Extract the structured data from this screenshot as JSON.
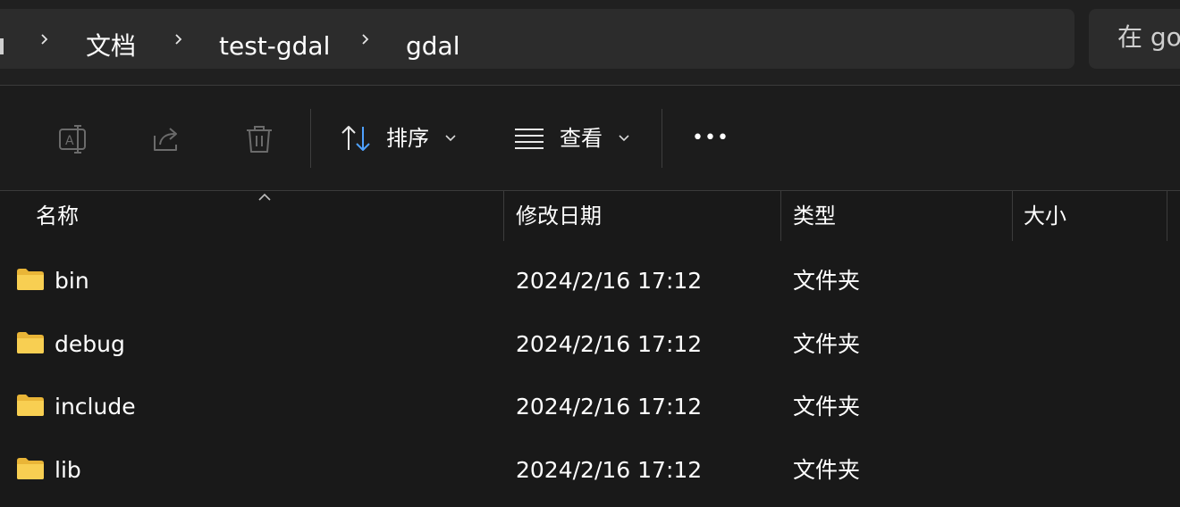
{
  "address_bar": {
    "breadcrumbs": [
      "文档",
      "test-gdal",
      "gdal"
    ]
  },
  "search": {
    "text": "在 go"
  },
  "command_bar": {
    "icons": [
      "rename-icon",
      "share-icon",
      "delete-icon"
    ],
    "sort_label": "排序",
    "view_label": "查看",
    "more_label": "•••"
  },
  "columns": {
    "name": "名称",
    "date_modified": "修改日期",
    "type": "类型",
    "size": "大小"
  },
  "files": [
    {
      "name": "bin",
      "date": "2024/2/16 17:12",
      "type": "文件夹",
      "size": ""
    },
    {
      "name": "debug",
      "date": "2024/2/16 17:12",
      "type": "文件夹",
      "size": ""
    },
    {
      "name": "include",
      "date": "2024/2/16 17:12",
      "type": "文件夹",
      "size": ""
    },
    {
      "name": "lib",
      "date": "2024/2/16 17:12",
      "type": "文件夹",
      "size": ""
    }
  ],
  "colors": {
    "background": "#191919",
    "folder": "#f3c63f",
    "accent": "#4ea1ff"
  }
}
